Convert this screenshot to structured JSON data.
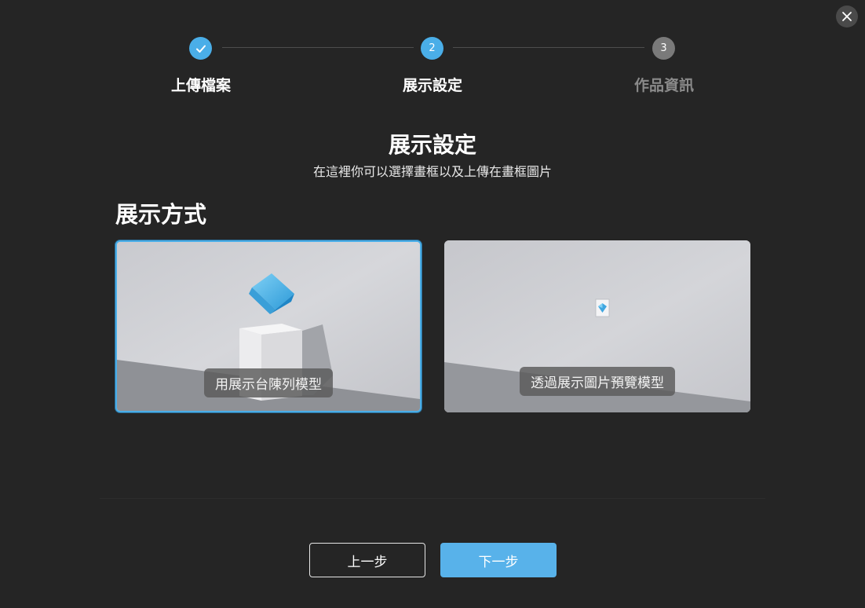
{
  "stepper": {
    "steps": [
      {
        "number": "",
        "label": "上傳檔案",
        "state": "completed"
      },
      {
        "number": "2",
        "label": "展示設定",
        "state": "current"
      },
      {
        "number": "3",
        "label": "作品資訊",
        "state": "upcoming"
      }
    ]
  },
  "header": {
    "title": "展示設定",
    "subtitle": "在這裡你可以選擇畫框以及上傳在畫框圖片"
  },
  "display_mode": {
    "heading": "展示方式",
    "options": [
      {
        "label": "用展示台陳列模型",
        "selected": true
      },
      {
        "label": "透過展示圖片預覽模型",
        "selected": false
      }
    ]
  },
  "footer": {
    "prev_label": "上一步",
    "next_label": "下一步"
  },
  "colors": {
    "accent": "#4aaee8",
    "background": "#252525",
    "inactive_step": "#7a7a7a"
  }
}
